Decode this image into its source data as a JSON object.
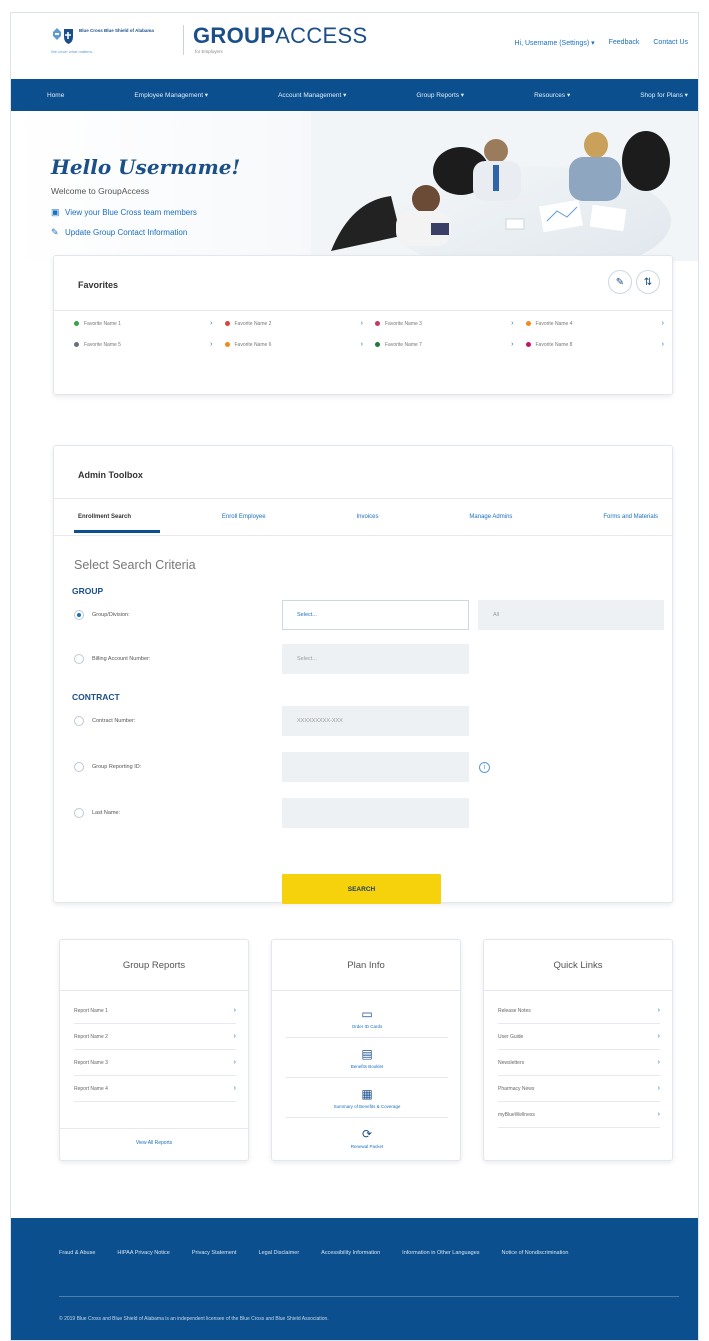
{
  "header": {
    "logo_text": "Blue Cross Blue Shield of Alabama",
    "logo_tagline": "We cover what matters.",
    "brand_bold": "GROUP",
    "brand_light": "ACCESS",
    "brand_sub": "for Employers",
    "user_menu": "Hi, Username (Settings) ▾",
    "feedback": "Feedback",
    "contact": "Contact Us"
  },
  "nav": {
    "items": [
      "Home",
      "Employee Management ▾",
      "Account Management ▾",
      "Group Reports ▾",
      "Resources ▾",
      "Shop for Plans ▾"
    ]
  },
  "hero": {
    "greeting": "Hello Username!",
    "welcome": "Welcome to GroupAccess",
    "link1": "View your Blue Cross team members",
    "link2": "Update Group Contact Information"
  },
  "favorites": {
    "title": "Favorites",
    "items": [
      {
        "label": "Favorite Name 1",
        "color": "#3aa14a"
      },
      {
        "label": "Favorite Name 2",
        "color": "#d9433e"
      },
      {
        "label": "Favorite Name 3",
        "color": "#c23a62"
      },
      {
        "label": "Favorite Name 4",
        "color": "#f08a1c"
      },
      {
        "label": "Favorite Name 5",
        "color": "#6a6f78"
      },
      {
        "label": "Favorite Name 6",
        "color": "#f08a1c"
      },
      {
        "label": "Favorite Name 7",
        "color": "#1e7b3c"
      },
      {
        "label": "Favorite Name 8",
        "color": "#c2185b"
      }
    ]
  },
  "admin": {
    "title": "Admin Toolbox",
    "tabs": [
      "Enrollment Search",
      "Enroll Employee",
      "Invoices",
      "Manage Admins",
      "Forms and Materials"
    ],
    "criteria_title": "Select Search Criteria",
    "group_label": "GROUP",
    "contract_label": "CONTRACT",
    "rows": {
      "group_division": "Group/Division:",
      "billing": "Billing Account Number:",
      "contract_number": "Contract Number:",
      "group_reporting": "Group Reporting ID:",
      "last_name": "Last Name:"
    },
    "select_placeholder": "Select...",
    "all_placeholder": "All",
    "billing_placeholder": "Select...",
    "contract_placeholder": "XXXXXXXXX-XXX",
    "search_button": "SEARCH"
  },
  "group_reports": {
    "title": "Group Reports",
    "items": [
      "Report Name 1",
      "Report Name 2",
      "Report Name 3",
      "Report Name 4"
    ],
    "view_all": "View All Reports"
  },
  "plan_info": {
    "title": "Plan Info",
    "items": [
      {
        "label": "Order ID Cards",
        "icon": "id-card-icon"
      },
      {
        "label": "Benefits Booklet",
        "icon": "booklet-icon"
      },
      {
        "label": "Summary of Benefits & Coverage",
        "icon": "summary-icon"
      },
      {
        "label": "Renewal Packet",
        "icon": "renewal-icon"
      }
    ]
  },
  "quick_links": {
    "title": "Quick Links",
    "items": [
      "Release Notes",
      "User Guide",
      "Newsletters",
      "Pharmacy News",
      "myBlueWellness"
    ]
  },
  "footer": {
    "links": [
      "Fraud & Abuse",
      "HIPAA Privacy Notice",
      "Privacy Statement",
      "Legal Disclaimer",
      "Accessibility Information",
      "Information in Other Languages",
      "Notice of Nondiscrimination"
    ],
    "copyright": "© 2019 Blue Cross and Blue Shield of Alabama is an independent licensee of the Blue Cross and Blue Shield Association."
  }
}
